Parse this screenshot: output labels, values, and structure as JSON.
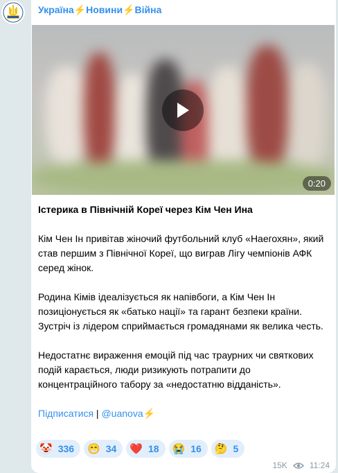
{
  "channel": {
    "name": "Україна⚡Новини⚡Війна",
    "avatar_colors": {
      "background": "#ffffff",
      "emblem": "#f0c419",
      "ring": "#2c5aa0"
    }
  },
  "video": {
    "duration": "0:20",
    "icon": "play-icon"
  },
  "post": {
    "title": "Істерика в Північній Кореї через Кім Чен Ина",
    "paragraphs": [
      "Кім Чен Ін привітав жіночий футбольний клуб «Наегохян», який став першим з Північної Кореї, що виграв Лігу чемпіонів АФК серед жінок.",
      "Родина Кімів ідеалізується як напівбоги, а Кім Чен Ін позиціонується як «батько нації» та гарант безпеки країни. Зустріч із лідером сприймається громадянами як велика честь.",
      "Недостатнє вираження емоцій під час траурних чи святкових подій карається, люди ризикують потрапити до концентраційного табору за «недостатню відданість»."
    ],
    "subscribe_label": "Підписатися",
    "separator": " | ",
    "handle": "@uanova",
    "handle_suffix": "⚡"
  },
  "reactions": [
    {
      "emoji": "🤡",
      "count": "336"
    },
    {
      "emoji": "😁",
      "count": "34"
    },
    {
      "emoji": "❤️",
      "count": "18"
    },
    {
      "emoji": "😭",
      "count": "16"
    },
    {
      "emoji": "🤔",
      "count": "5"
    }
  ],
  "meta": {
    "views": "15K",
    "views_icon": "eye-icon",
    "time": "11:24"
  },
  "colors": {
    "accent": "#3390ec",
    "chat_background": "#dfe9ec",
    "reaction_background": "#e2eefb",
    "meta_text": "#8a9aa6"
  }
}
